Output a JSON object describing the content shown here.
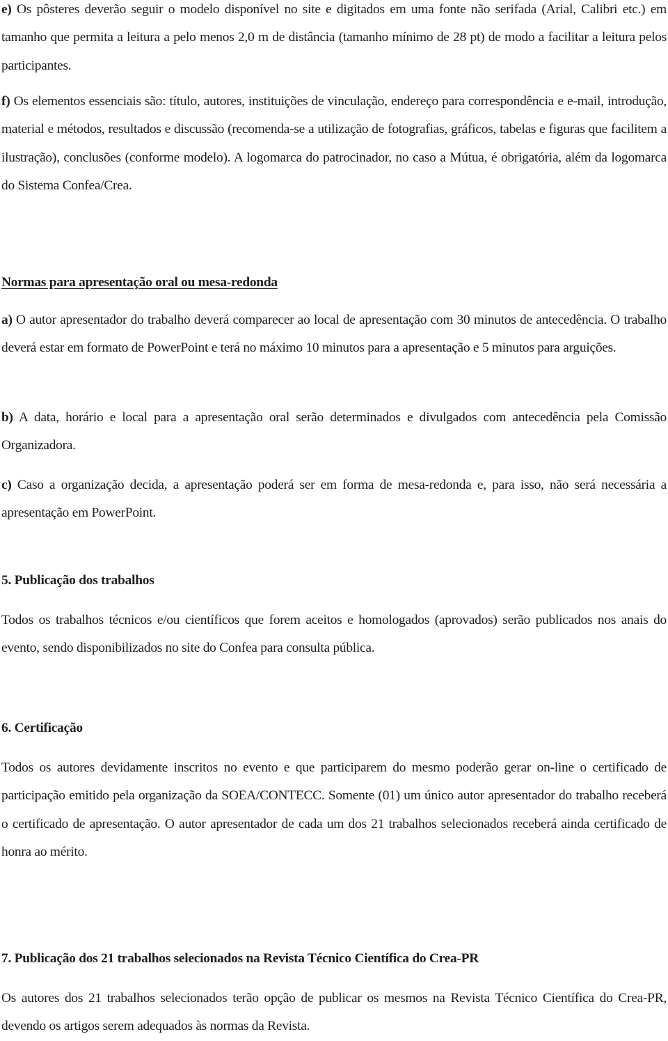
{
  "posters": {
    "item_e": {
      "marker": "e)",
      "text": " Os pôsteres deverão seguir o modelo disponível no site e digitados em uma fonte não serifada (Arial, Calibri etc.) em tamanho que permita a leitura a pelo menos 2,0 m de distância (tamanho mínimo de 28 pt) de modo a facilitar a leitura pelos participantes."
    },
    "item_f": {
      "marker": "f)",
      "text": " Os elementos essenciais são: título, autores, instituições de vinculação, endereço para correspondência e e-mail, introdução, material e métodos, resultados e discussão (recomenda-se a utilização de fotografias, gráficos, tabelas e figuras que facilitem a ilustração), conclusões (conforme modelo). A logomarca do patrocinador, no caso a Mútua, é obrigatória, além da logomarca do Sistema Confea/Crea."
    }
  },
  "oral": {
    "heading": "Normas para apresentação oral ou mesa-redonda",
    "item_a": {
      "marker": "a)",
      "text": " O autor apresentador do trabalho deverá comparecer ao local de apresentação com 30 minutos de antecedência. O trabalho deverá estar em formato de PowerPoint e terá no máximo 10 minutos para a apresentação e 5 minutos para arguições."
    },
    "item_b": {
      "marker": "b)",
      "text": " A data, horário e local para a apresentação oral serão determinados e divulgados com antecedência pela Comissão Organizadora."
    },
    "item_c": {
      "marker": "c)",
      "text": " Caso a organização decida, a apresentação poderá ser em forma de mesa-redonda e, para isso, não será necessária a apresentação em PowerPoint."
    }
  },
  "section5": {
    "heading": "5. Publicação dos trabalhos",
    "text": "Todos os trabalhos técnicos e/ou científicos que forem aceitos e homologados (aprovados) serão publicados nos anais do evento, sendo disponibilizados no site do Confea para consulta pública."
  },
  "section6": {
    "heading": "6. Certificação",
    "text": "Todos os autores devidamente inscritos no evento e que participarem do mesmo poderão gerar on-line o certificado de participação emitido pela organização da SOEA/CONTECC. Somente (01) um único autor apresentador do trabalho receberá o certificado de apresentação. O autor apresentador de cada um dos 21 trabalhos selecionados receberá ainda certificado de honra ao mérito."
  },
  "section7": {
    "heading": "7. Publicação dos 21 trabalhos selecionados na Revista Técnico Científica do Crea-PR",
    "text": "Os autores dos 21 trabalhos selecionados terão opção de publicar os mesmos na Revista Técnico Científica do Crea-PR, devendo os artigos serem adequados às normas da Revista."
  }
}
